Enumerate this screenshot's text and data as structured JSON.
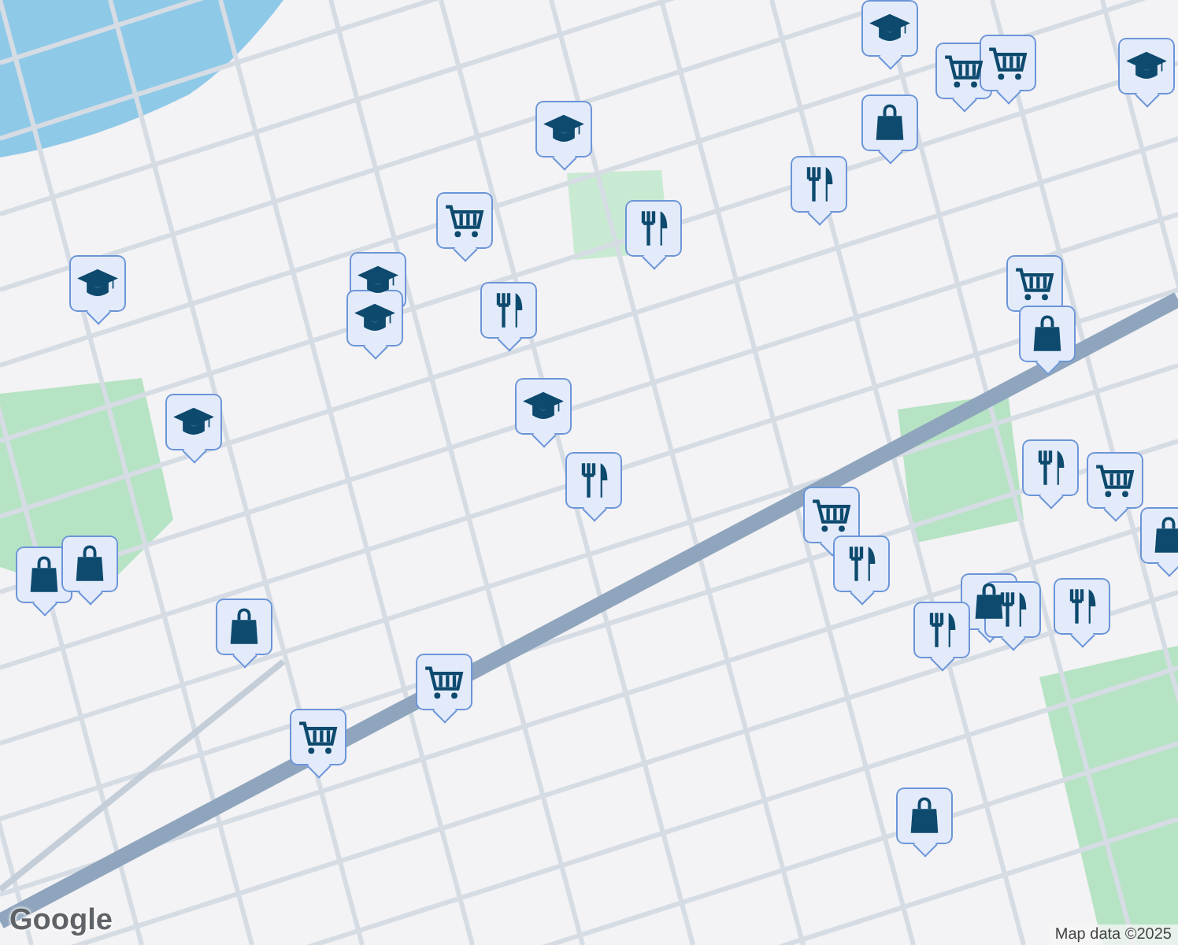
{
  "markers": [
    {
      "kind": "school"
    },
    {
      "kind": "cart"
    },
    {
      "kind": "restaurant"
    },
    {
      "kind": "school"
    },
    {
      "kind": "school"
    },
    {
      "kind": "school"
    },
    {
      "kind": "restaurant"
    },
    {
      "kind": "school"
    },
    {
      "kind": "school"
    },
    {
      "kind": "restaurant"
    },
    {
      "kind": "shopping"
    },
    {
      "kind": "shopping"
    },
    {
      "kind": "shopping"
    },
    {
      "kind": "cart"
    },
    {
      "kind": "cart"
    },
    {
      "kind": "restaurant"
    },
    {
      "kind": "shopping"
    },
    {
      "kind": "school"
    },
    {
      "kind": "cart"
    },
    {
      "kind": "cart"
    },
    {
      "kind": "school"
    },
    {
      "kind": "cart"
    },
    {
      "kind": "shopping"
    },
    {
      "kind": "restaurant"
    },
    {
      "kind": "cart"
    },
    {
      "kind": "shopping"
    },
    {
      "kind": "cart"
    },
    {
      "kind": "restaurant"
    },
    {
      "kind": "shopping"
    },
    {
      "kind": "restaurant"
    },
    {
      "kind": "restaurant"
    },
    {
      "kind": "restaurant"
    },
    {
      "kind": "shopping"
    }
  ],
  "logo": "Google",
  "attribution": "Map data ©2025"
}
